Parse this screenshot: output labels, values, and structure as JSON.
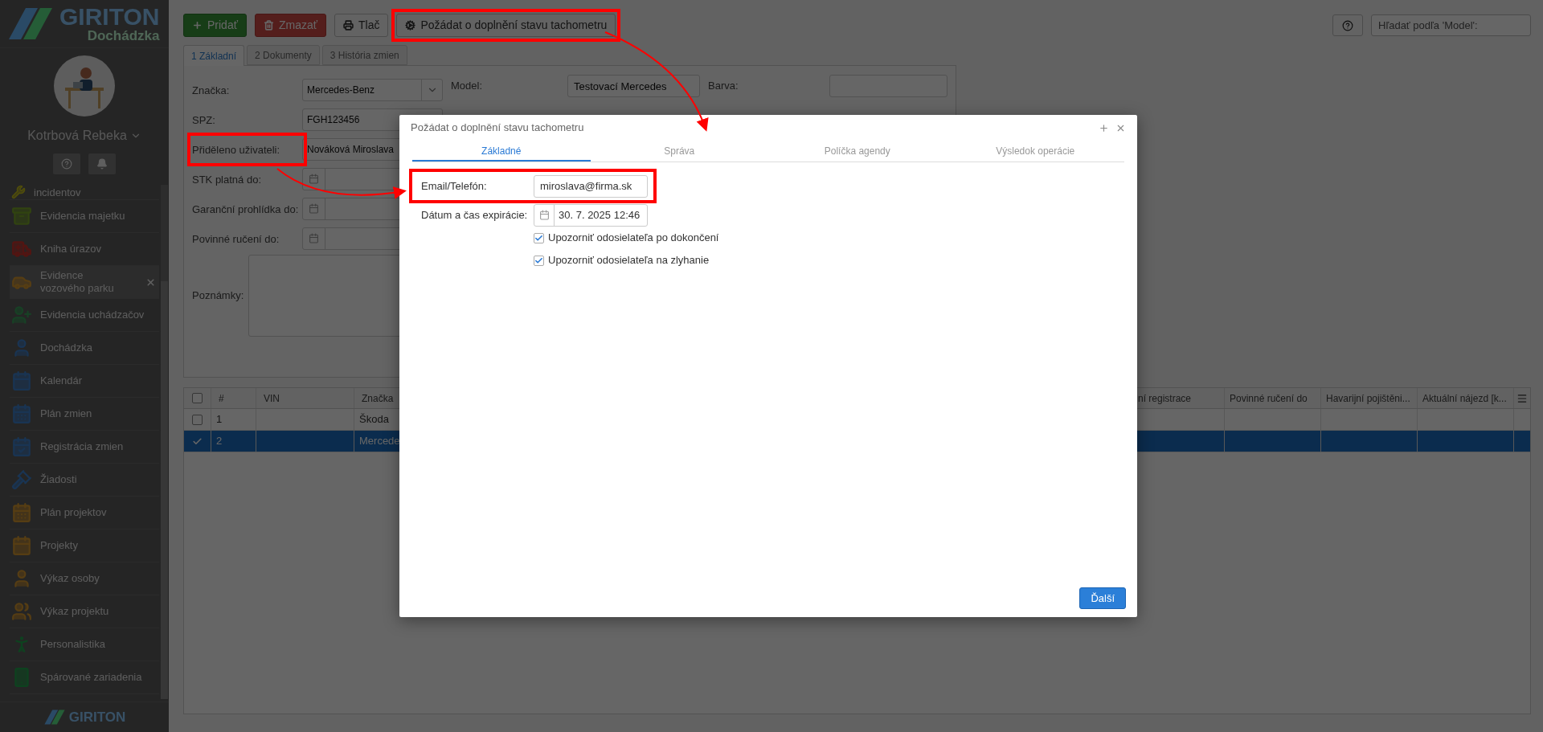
{
  "sidebar": {
    "brand": "GIRITON",
    "product": "Dochádzka",
    "user": "Kotrbová Rebeka",
    "menu": [
      {
        "label": "incidentov",
        "selected": false
      },
      {
        "label": "Evidencia majetku",
        "selected": false
      },
      {
        "label": "Kniha úrazov",
        "selected": false
      },
      {
        "label": "Evidence vozového parku",
        "selected": true
      },
      {
        "label": "Evidencia uchádzačov",
        "selected": false
      },
      {
        "label": "Dochádzka",
        "selected": false
      },
      {
        "label": "Kalendár",
        "selected": false
      },
      {
        "label": "Plán zmien",
        "selected": false
      },
      {
        "label": "Registrácia zmien",
        "selected": false
      },
      {
        "label": "Žiadosti",
        "selected": false
      },
      {
        "label": "Plán projektov",
        "selected": false
      },
      {
        "label": "Projekty",
        "selected": false
      },
      {
        "label": "Výkaz osoby",
        "selected": false
      },
      {
        "label": "Výkaz projektu",
        "selected": false
      },
      {
        "label": "Personalistika",
        "selected": false
      },
      {
        "label": "Spárované zariadenia",
        "selected": false
      }
    ],
    "footer_brand": "GIRITON"
  },
  "toolbar": {
    "buttons": [
      {
        "label": "Pridať",
        "kind": "add"
      },
      {
        "label": "Zmazať",
        "kind": "delete"
      },
      {
        "label": "Tlač",
        "kind": "print"
      },
      {
        "label": "Požádat o doplnění stavu tachometru",
        "kind": "request"
      }
    ],
    "search": {
      "placeholder": "Hľadať podľa 'Model':"
    }
  },
  "form": {
    "tabs": [
      {
        "label": "1 Základní",
        "selected": true
      },
      {
        "label": "2 Dokumenty",
        "selected": false
      },
      {
        "label": "3 História zmien",
        "selected": false
      }
    ],
    "fields": [
      {
        "label": "Značka:",
        "kind": "select",
        "value": "Mercedes-Benz"
      },
      {
        "label": "SPZ:",
        "kind": "text",
        "value": "FGH123456"
      },
      {
        "label": "Přiděleno uživateli:",
        "kind": "text",
        "value": "Nováková Miroslava"
      },
      {
        "label": "STK platná do:",
        "kind": "date"
      },
      {
        "label": "Garanční prohlídka do:",
        "kind": "date"
      },
      {
        "label": "Povinné ručení do:",
        "kind": "date"
      }
    ],
    "model": {
      "label": "Model:",
      "value": "Testovací Mercedes"
    },
    "color": {
      "label": "Barva:"
    },
    "notes": {
      "label": "Poznámky:"
    }
  },
  "table": {
    "all_selected": false,
    "columns_left": [
      "#",
      "VIN",
      "Značka"
    ],
    "columns_right": [
      "ní registrace",
      "Povinné ručení do",
      "Havarijní pojištěni...",
      "Aktuální nájezd [k..."
    ],
    "rows": [
      {
        "selected": false,
        "cells": [
          "1",
          "",
          "Škoda"
        ]
      },
      {
        "selected": true,
        "cells": [
          "2",
          "",
          "Mercede"
        ]
      }
    ]
  },
  "dialog": {
    "title": "Požádat o doplnění stavu tachometru",
    "tabs": [
      {
        "label": "Základné",
        "selected": true
      },
      {
        "label": "Správa",
        "selected": false
      },
      {
        "label": "Políčka agendy",
        "selected": false
      },
      {
        "label": "Výsledok operácie",
        "selected": false
      }
    ],
    "email": {
      "label": "Email/Telefón:",
      "value": "miroslava@firma.sk"
    },
    "expiry": {
      "label": "Dátum a čas expirácie:",
      "value": "30. 7. 2025 12:46"
    },
    "options": [
      {
        "label": "Upozorniť odosielateľa po dokončení",
        "checked": true
      },
      {
        "label": "Upozorniť odosielateľa na zlyhanie",
        "checked": true
      }
    ],
    "next_button": "Ďalší"
  }
}
